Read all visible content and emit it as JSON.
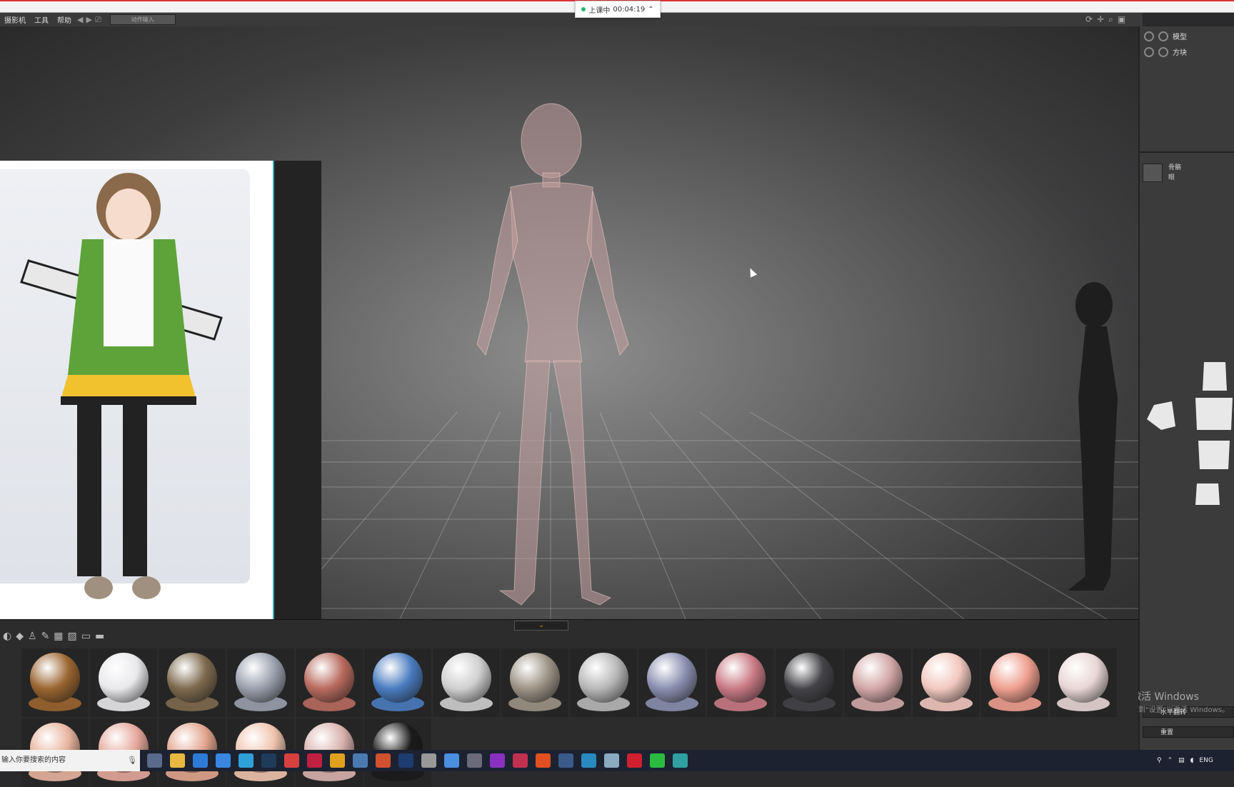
{
  "recording": {
    "label": "上课中",
    "time": "00:04:19"
  },
  "menu": {
    "items": [
      "摄影机",
      "工具",
      "帮助"
    ],
    "input": "动作输入"
  },
  "right_panel": {
    "items": [
      "模型",
      "方块"
    ],
    "sub_items": [
      "骨骼",
      "眼"
    ],
    "buttons": [
      "水平翻转",
      "重置"
    ]
  },
  "watermark": {
    "line1": "激活 Windows",
    "line2": "转到\"设置\"以激活 Windows。"
  },
  "materials": {
    "colors": [
      "#9a6530",
      "#e9e9ec",
      "#7d6a4e",
      "#9aa0ad",
      "#b86a5e",
      "#4a7cc0",
      "#cfcfcf",
      "#9d9386",
      "#b8b8b8",
      "#8a8fb0",
      "#c97a84",
      "#444448",
      "#d3a7a7",
      "#f2c8bf",
      "#ee9f8f",
      "#e9d6d6",
      "#e8b49e",
      "#e6a89c",
      "#e2a58e",
      "#f0c4ae",
      "#d9b2ae",
      "#1b1b1b"
    ]
  },
  "taskbar": {
    "search": "输入你要搜索的内容",
    "lang": "ENG"
  }
}
